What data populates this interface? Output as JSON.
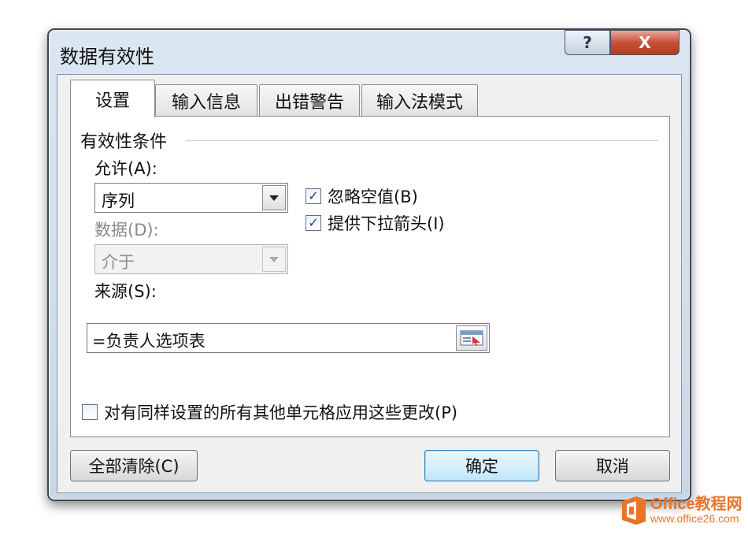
{
  "window": {
    "title": "数据有效性"
  },
  "caption_buttons": {
    "help": "?",
    "close": "X"
  },
  "tabs": [
    {
      "label": "设置",
      "active": true
    },
    {
      "label": "输入信息",
      "active": false
    },
    {
      "label": "出错警告",
      "active": false
    },
    {
      "label": "输入法模式",
      "active": false
    }
  ],
  "settings": {
    "group_title": "有效性条件",
    "allow_label": "允许(A):",
    "allow_value": "序列",
    "data_label": "数据(D):",
    "data_value": "介于",
    "ignore_blank": {
      "label": "忽略空值(B)",
      "checked": true
    },
    "dropdown_arrow": {
      "label": "提供下拉箭头(I)",
      "checked": true
    },
    "source_label": "来源(S):",
    "source_value": "=负责人选项表",
    "apply_all": {
      "label": "对有同样设置的所有其他单元格应用这些更改(P)",
      "checked": false
    }
  },
  "buttons": {
    "clear_all": "全部清除(C)",
    "ok": "确定",
    "cancel": "取消"
  },
  "watermark": {
    "brand": "Office教程网",
    "url": "www.office26.com"
  }
}
